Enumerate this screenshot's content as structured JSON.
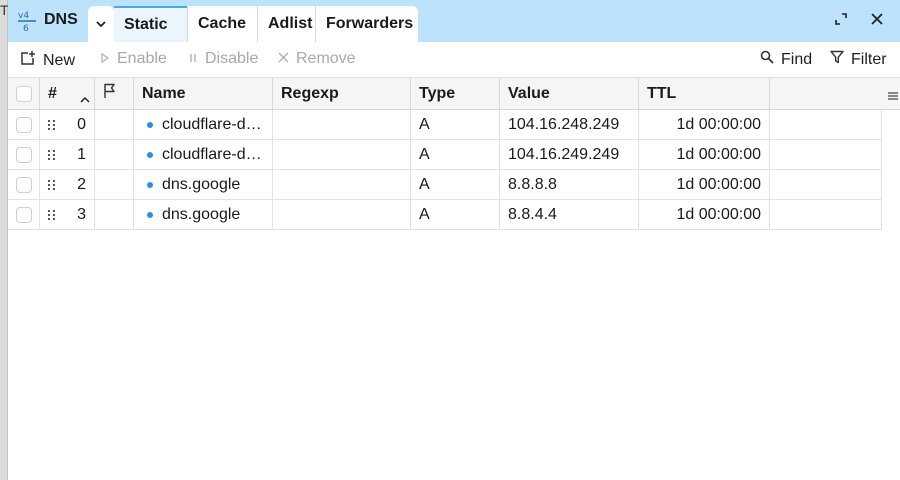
{
  "window": {
    "app_title": "DNS",
    "tabs": [
      {
        "label": "Static",
        "active": true
      },
      {
        "label": "Cache",
        "active": false
      },
      {
        "label": "Adlist",
        "active": false
      },
      {
        "label": "Forwarders",
        "active": false
      }
    ]
  },
  "toolbar": {
    "new_label": "New",
    "enable_label": "Enable",
    "disable_label": "Disable",
    "remove_label": "Remove",
    "find_label": "Find",
    "filter_label": "Filter"
  },
  "table": {
    "headers": {
      "index": "#",
      "name": "Name",
      "regexp": "Regexp",
      "type": "Type",
      "value": "Value",
      "ttl": "TTL"
    },
    "rows": [
      {
        "index": "0",
        "name": "cloudflare-dns.com",
        "regexp": "",
        "type": "A",
        "value": "104.16.248.249",
        "ttl": "1d 00:00:00"
      },
      {
        "index": "1",
        "name": "cloudflare-dns.com",
        "regexp": "",
        "type": "A",
        "value": "104.16.249.249",
        "ttl": "1d 00:00:00"
      },
      {
        "index": "2",
        "name": "dns.google",
        "regexp": "",
        "type": "A",
        "value": "8.8.8.8",
        "ttl": "1d 00:00:00"
      },
      {
        "index": "3",
        "name": "dns.google",
        "regexp": "",
        "type": "A",
        "value": "8.8.4.4",
        "ttl": "1d 00:00:00"
      }
    ]
  },
  "colors": {
    "titlebar": "#bde2fb",
    "accent": "#2e8fe0",
    "active_tab_bg": "#eaf5fd"
  },
  "icons": [
    "ipv4-dns-icon",
    "chevron-down-icon",
    "restore-icon",
    "close-icon",
    "new-icon",
    "enable-icon",
    "disable-icon",
    "remove-icon",
    "search-icon",
    "filter-icon",
    "sort-asc-icon",
    "flag-icon",
    "column-menu-icon",
    "drag-handle-icon"
  ]
}
